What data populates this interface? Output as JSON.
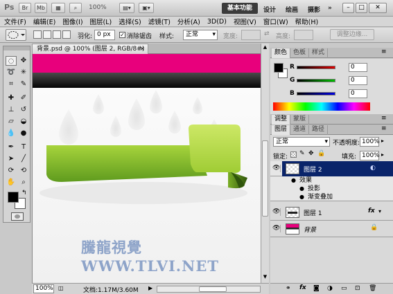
{
  "titlebar": {
    "logo": "Ps",
    "btn_br": "Br",
    "btn_mb": "Mb",
    "zoom": "100%",
    "workspace_active": "基本功能",
    "workspaces": [
      "设计",
      "绘画",
      "摄影"
    ],
    "more": "»"
  },
  "menu": [
    "文件(F)",
    "编辑(E)",
    "图像(I)",
    "图层(L)",
    "选择(S)",
    "滤镜(T)",
    "分析(A)",
    "3D(D)",
    "视图(V)",
    "窗口(W)",
    "帮助(H)"
  ],
  "options": {
    "feather_label": "羽化:",
    "feather_value": "0 px",
    "antialias_label": "消除锯齿",
    "antialias_checked": "✓",
    "style_label": "样式:",
    "style_value": "正常",
    "width_label": "宽度:",
    "height_label": "高度:",
    "refine_label": "调整边缘..."
  },
  "document": {
    "tab_title": "背景.psd @ 100% (图层 2, RGB/8#) *",
    "tab_close": "×",
    "watermark": "騰龍視覺 WWW.TLVI.NET",
    "status_zoom": "100%",
    "status_doc": "文档:1.17M/3.60M"
  },
  "color_panel": {
    "tabs": [
      "颜色",
      "色板",
      "样式"
    ],
    "channels": [
      {
        "name": "R",
        "value": "0",
        "color": "#d40000"
      },
      {
        "name": "G",
        "value": "0",
        "color": "#00b000"
      },
      {
        "name": "B",
        "value": "0",
        "color": "#0000d0"
      }
    ]
  },
  "adjust_tabs": [
    "调整",
    "蒙版"
  ],
  "layers_panel": {
    "tabs": [
      "图层",
      "通道",
      "路径"
    ],
    "blend_mode": "正常",
    "opacity_label": "不透明度:",
    "opacity_value": "100%",
    "lock_label": "锁定:",
    "fill_label": "填充:",
    "fill_value": "100%",
    "layers": [
      {
        "name": "图层 2",
        "selected": true
      },
      {
        "name": "图层 1",
        "selected": false,
        "fx": "fx"
      },
      {
        "name": "背景",
        "selected": false
      }
    ],
    "effects_label": "效果",
    "effects": [
      "投影",
      "渐变叠加"
    ]
  },
  "colors": {
    "pink": "#e8007c",
    "green_light": "#b6de4c",
    "green_dark": "#6da521",
    "selection": "#0a246a",
    "watermark": "#8ea4c9"
  }
}
